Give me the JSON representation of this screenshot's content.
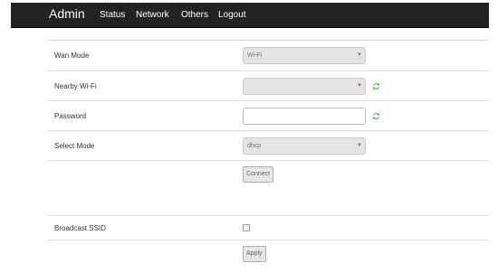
{
  "navbar": {
    "brand": "Admin",
    "links": [
      "Status",
      "Network",
      "Others",
      "Logout"
    ]
  },
  "form": {
    "wan_mode": {
      "label": "Wan Mode",
      "value": "Wi-Fi"
    },
    "nearby_wifi": {
      "label": "Nearby Wi-Fi",
      "value": ""
    },
    "password": {
      "label": "Password",
      "value": ""
    },
    "select_mode": {
      "label": "Select Mode",
      "value": "dhcp"
    },
    "connect_label": "Connect",
    "broadcast_ssid": {
      "label": "Broadcast SSID",
      "checked": false
    },
    "apply_label": "Apply"
  },
  "colors": {
    "navbar_bg": "#222222",
    "refresh_icon": "#5cb85c"
  },
  "icons": {
    "refresh": "refresh-icon",
    "dropdown": "caret-down"
  }
}
